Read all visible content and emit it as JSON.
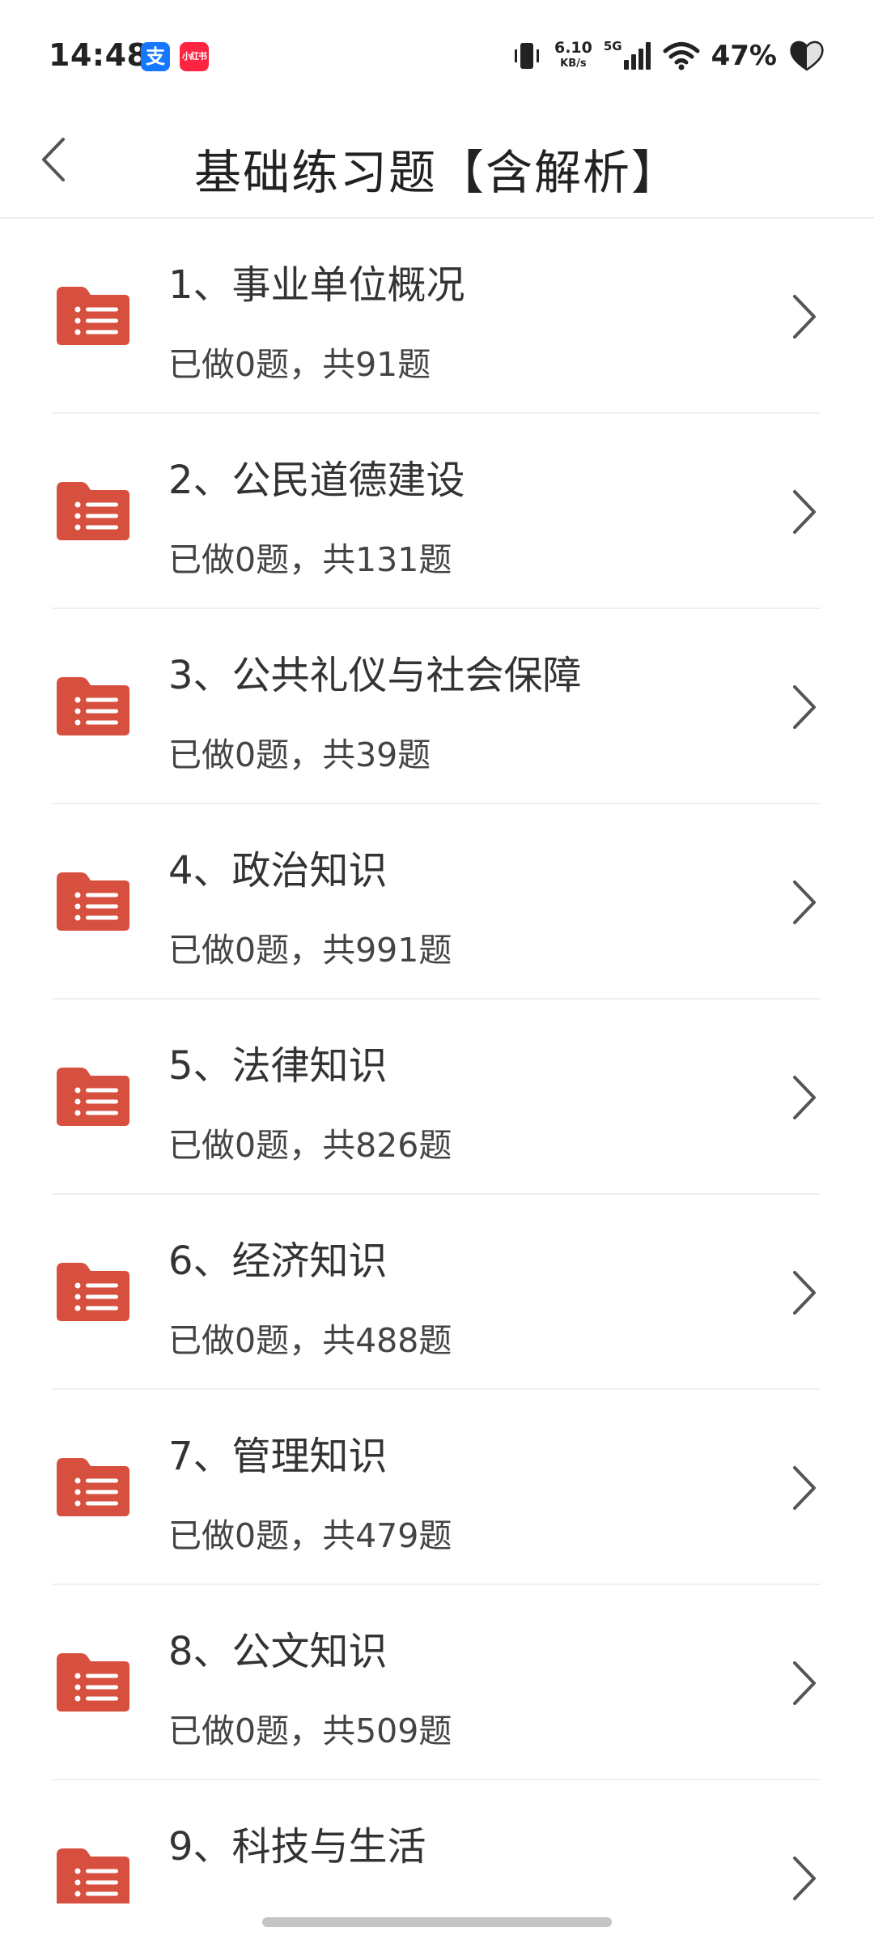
{
  "status_bar": {
    "time": "14:48",
    "apps": [
      {
        "name": "alipay",
        "glyph": "支",
        "color": "#1677ff"
      },
      {
        "name": "xiaohongshu",
        "glyph": "小红书",
        "color": "#ff2442"
      }
    ],
    "network_speed": "6.10",
    "network_speed_unit": "KB/s",
    "network_type": "5G",
    "battery": "47%",
    "icons": [
      "vibrate-icon",
      "signal-icon",
      "wifi-icon",
      "battery-icon"
    ]
  },
  "header": {
    "title": "基础练习题【含解析】",
    "back_icon": "back-arrow-icon"
  },
  "colors": {
    "folder_red": "#d64f3f",
    "divider": "#efefef",
    "chevron": "#555555"
  },
  "list": {
    "item_icon": "list-folder-icon",
    "chevron_icon": "chevron-right-icon",
    "items": [
      {
        "title": "1、事业单位概况",
        "progress": "已做0题，共91题"
      },
      {
        "title": "2、公民道德建设",
        "progress": "已做0题，共131题"
      },
      {
        "title": "3、公共礼仪与社会保障",
        "progress": "已做0题，共39题"
      },
      {
        "title": "4、政治知识",
        "progress": "已做0题，共991题"
      },
      {
        "title": "5、法律知识",
        "progress": "已做0题，共826题"
      },
      {
        "title": "6、经济知识",
        "progress": "已做0题，共488题"
      },
      {
        "title": "7、管理知识",
        "progress": "已做0题，共479题"
      },
      {
        "title": "8、公文知识",
        "progress": "已做0题，共509题"
      },
      {
        "title": "9、科技与生活",
        "progress": ""
      }
    ]
  }
}
